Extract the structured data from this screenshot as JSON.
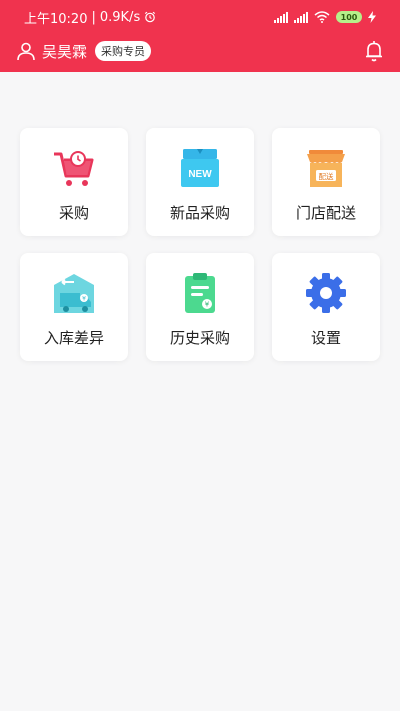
{
  "status_bar": {
    "time": "上午10:20",
    "speed": "0.9K/s",
    "battery": "100"
  },
  "header": {
    "user_name": "吴昊霖",
    "role_badge": "采购专员"
  },
  "menu": [
    {
      "label": "采购",
      "icon": "shopping-cart-icon"
    },
    {
      "label": "新品采购",
      "icon": "new-box-icon",
      "icon_text": "NEW"
    },
    {
      "label": "门店配送",
      "icon": "store-delivery-icon",
      "icon_text": "配送"
    },
    {
      "label": "入库差异",
      "icon": "warehouse-truck-icon"
    },
    {
      "label": "历史采购",
      "icon": "clipboard-icon"
    },
    {
      "label": "设置",
      "icon": "gear-icon"
    }
  ],
  "colors": {
    "brand": "#f0334e",
    "background": "#f7f7f8"
  }
}
